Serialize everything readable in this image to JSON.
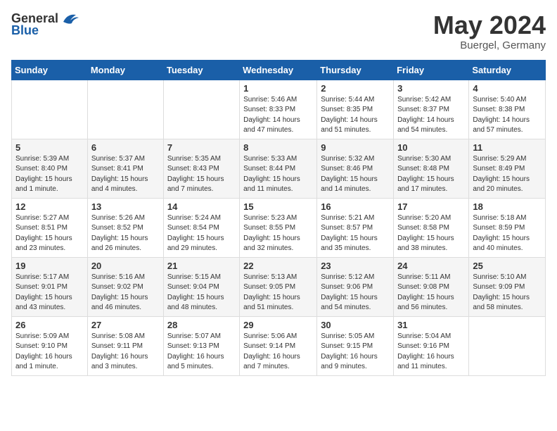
{
  "header": {
    "logo": {
      "general": "General",
      "blue": "Blue"
    },
    "title": "May 2024",
    "location": "Buergel, Germany"
  },
  "calendar": {
    "headers": [
      "Sunday",
      "Monday",
      "Tuesday",
      "Wednesday",
      "Thursday",
      "Friday",
      "Saturday"
    ],
    "weeks": [
      [
        {
          "day": "",
          "info": ""
        },
        {
          "day": "",
          "info": ""
        },
        {
          "day": "",
          "info": ""
        },
        {
          "day": "1",
          "info": "Sunrise: 5:46 AM\nSunset: 8:33 PM\nDaylight: 14 hours\nand 47 minutes."
        },
        {
          "day": "2",
          "info": "Sunrise: 5:44 AM\nSunset: 8:35 PM\nDaylight: 14 hours\nand 51 minutes."
        },
        {
          "day": "3",
          "info": "Sunrise: 5:42 AM\nSunset: 8:37 PM\nDaylight: 14 hours\nand 54 minutes."
        },
        {
          "day": "4",
          "info": "Sunrise: 5:40 AM\nSunset: 8:38 PM\nDaylight: 14 hours\nand 57 minutes."
        }
      ],
      [
        {
          "day": "5",
          "info": "Sunrise: 5:39 AM\nSunset: 8:40 PM\nDaylight: 15 hours\nand 1 minute."
        },
        {
          "day": "6",
          "info": "Sunrise: 5:37 AM\nSunset: 8:41 PM\nDaylight: 15 hours\nand 4 minutes."
        },
        {
          "day": "7",
          "info": "Sunrise: 5:35 AM\nSunset: 8:43 PM\nDaylight: 15 hours\nand 7 minutes."
        },
        {
          "day": "8",
          "info": "Sunrise: 5:33 AM\nSunset: 8:44 PM\nDaylight: 15 hours\nand 11 minutes."
        },
        {
          "day": "9",
          "info": "Sunrise: 5:32 AM\nSunset: 8:46 PM\nDaylight: 15 hours\nand 14 minutes."
        },
        {
          "day": "10",
          "info": "Sunrise: 5:30 AM\nSunset: 8:48 PM\nDaylight: 15 hours\nand 17 minutes."
        },
        {
          "day": "11",
          "info": "Sunrise: 5:29 AM\nSunset: 8:49 PM\nDaylight: 15 hours\nand 20 minutes."
        }
      ],
      [
        {
          "day": "12",
          "info": "Sunrise: 5:27 AM\nSunset: 8:51 PM\nDaylight: 15 hours\nand 23 minutes."
        },
        {
          "day": "13",
          "info": "Sunrise: 5:26 AM\nSunset: 8:52 PM\nDaylight: 15 hours\nand 26 minutes."
        },
        {
          "day": "14",
          "info": "Sunrise: 5:24 AM\nSunset: 8:54 PM\nDaylight: 15 hours\nand 29 minutes."
        },
        {
          "day": "15",
          "info": "Sunrise: 5:23 AM\nSunset: 8:55 PM\nDaylight: 15 hours\nand 32 minutes."
        },
        {
          "day": "16",
          "info": "Sunrise: 5:21 AM\nSunset: 8:57 PM\nDaylight: 15 hours\nand 35 minutes."
        },
        {
          "day": "17",
          "info": "Sunrise: 5:20 AM\nSunset: 8:58 PM\nDaylight: 15 hours\nand 38 minutes."
        },
        {
          "day": "18",
          "info": "Sunrise: 5:18 AM\nSunset: 8:59 PM\nDaylight: 15 hours\nand 40 minutes."
        }
      ],
      [
        {
          "day": "19",
          "info": "Sunrise: 5:17 AM\nSunset: 9:01 PM\nDaylight: 15 hours\nand 43 minutes."
        },
        {
          "day": "20",
          "info": "Sunrise: 5:16 AM\nSunset: 9:02 PM\nDaylight: 15 hours\nand 46 minutes."
        },
        {
          "day": "21",
          "info": "Sunrise: 5:15 AM\nSunset: 9:04 PM\nDaylight: 15 hours\nand 48 minutes."
        },
        {
          "day": "22",
          "info": "Sunrise: 5:13 AM\nSunset: 9:05 PM\nDaylight: 15 hours\nand 51 minutes."
        },
        {
          "day": "23",
          "info": "Sunrise: 5:12 AM\nSunset: 9:06 PM\nDaylight: 15 hours\nand 54 minutes."
        },
        {
          "day": "24",
          "info": "Sunrise: 5:11 AM\nSunset: 9:08 PM\nDaylight: 15 hours\nand 56 minutes."
        },
        {
          "day": "25",
          "info": "Sunrise: 5:10 AM\nSunset: 9:09 PM\nDaylight: 15 hours\nand 58 minutes."
        }
      ],
      [
        {
          "day": "26",
          "info": "Sunrise: 5:09 AM\nSunset: 9:10 PM\nDaylight: 16 hours\nand 1 minute."
        },
        {
          "day": "27",
          "info": "Sunrise: 5:08 AM\nSunset: 9:11 PM\nDaylight: 16 hours\nand 3 minutes."
        },
        {
          "day": "28",
          "info": "Sunrise: 5:07 AM\nSunset: 9:13 PM\nDaylight: 16 hours\nand 5 minutes."
        },
        {
          "day": "29",
          "info": "Sunrise: 5:06 AM\nSunset: 9:14 PM\nDaylight: 16 hours\nand 7 minutes."
        },
        {
          "day": "30",
          "info": "Sunrise: 5:05 AM\nSunset: 9:15 PM\nDaylight: 16 hours\nand 9 minutes."
        },
        {
          "day": "31",
          "info": "Sunrise: 5:04 AM\nSunset: 9:16 PM\nDaylight: 16 hours\nand 11 minutes."
        },
        {
          "day": "",
          "info": ""
        }
      ]
    ]
  }
}
